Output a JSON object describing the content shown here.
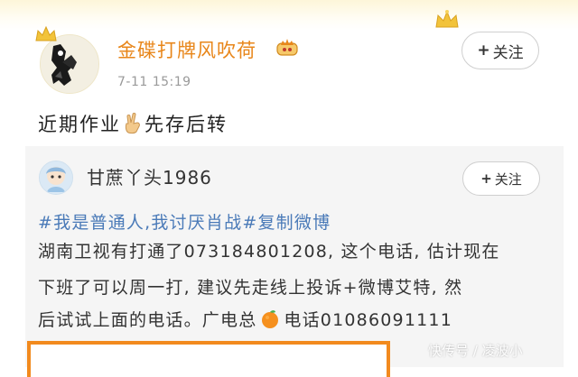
{
  "post": {
    "username": "金碟打牌风吹荷",
    "timestamp": "7-11 15:19",
    "follow_label": "关注",
    "follow_plus": "+",
    "text_before": "近期作业",
    "text_after": "先存后转",
    "username_color": "#e8861a"
  },
  "repost": {
    "username": "甘蔗丫头1986",
    "follow_label": "关注",
    "follow_plus": "+",
    "line1": "#我是普通人,我讨厌肖战#复制微博",
    "line2": "湖南卫视有打通了073184801208, 这个电话, 估计现在",
    "line3": "下班了可以周一打, 建议先走线上投诉+微博艾特, 然",
    "line4_before": "后试试上面的电话。广电总",
    "line4_after": "电话01086091111",
    "hashtag_color": "#4a7ab8"
  },
  "watermark": "快传号 / 凌波小",
  "icons": {
    "crown": "crown-icon",
    "vip": "vip-crown-badge-icon",
    "hand": "victory-hand-icon",
    "orange": "orange-fruit-icon"
  },
  "colors": {
    "accent_orange": "#f28a1e",
    "header_gold": "#fdf6d9",
    "repost_bg": "#f5f5f5"
  }
}
